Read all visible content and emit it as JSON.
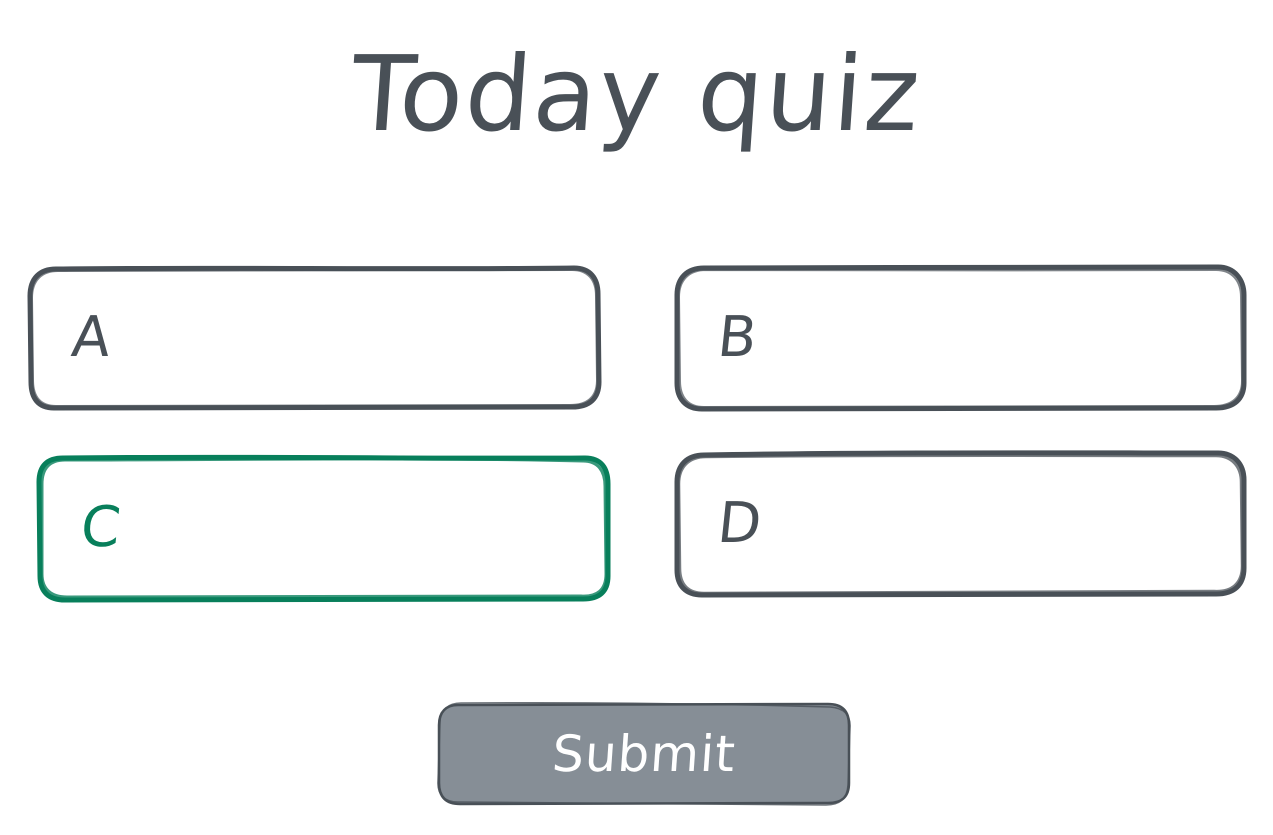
{
  "quiz": {
    "title": "Today quiz",
    "options": [
      {
        "label": "A",
        "selected": false
      },
      {
        "label": "B",
        "selected": false
      },
      {
        "label": "C",
        "selected": true
      },
      {
        "label": "D",
        "selected": false
      }
    ],
    "submit_label": "Submit"
  },
  "colors": {
    "ink": "#495057",
    "selected": "#087f5b",
    "button_fill": "#868e96",
    "button_text": "#ffffff",
    "background": "#ffffff"
  }
}
